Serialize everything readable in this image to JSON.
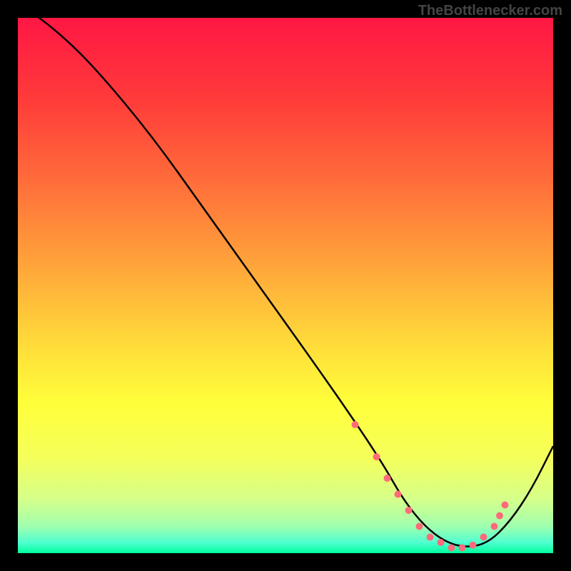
{
  "watermark": "TheBottlenecker.com",
  "chart_data": {
    "type": "line",
    "title": "",
    "xlabel": "",
    "ylabel": "",
    "xlim": [
      0,
      100
    ],
    "ylim": [
      0,
      100
    ],
    "gradient_stops": [
      {
        "offset": 0,
        "color": "#ff1744"
      },
      {
        "offset": 15,
        "color": "#ff3a3a"
      },
      {
        "offset": 30,
        "color": "#ff6b3a"
      },
      {
        "offset": 45,
        "color": "#ffa03a"
      },
      {
        "offset": 60,
        "color": "#ffd83a"
      },
      {
        "offset": 72,
        "color": "#ffff3a"
      },
      {
        "offset": 82,
        "color": "#f5ff5a"
      },
      {
        "offset": 90,
        "color": "#d5ff8a"
      },
      {
        "offset": 95,
        "color": "#a0ffb0"
      },
      {
        "offset": 98,
        "color": "#50ffd0"
      },
      {
        "offset": 100,
        "color": "#00ff9c"
      }
    ],
    "curve": {
      "x": [
        0,
        8,
        15,
        25,
        35,
        45,
        55,
        62,
        68,
        72,
        76,
        80,
        84,
        88,
        92,
        96,
        100
      ],
      "y": [
        103,
        97,
        90,
        78,
        64,
        50,
        36,
        26,
        17,
        10,
        5,
        2,
        1,
        2,
        6,
        12,
        20
      ]
    },
    "markers": {
      "x": [
        63,
        67,
        69,
        71,
        73,
        75,
        77,
        79,
        81,
        83,
        85,
        87,
        89,
        90,
        91
      ],
      "y": [
        24,
        18,
        14,
        11,
        8,
        5,
        3,
        2,
        1,
        1,
        1.5,
        3,
        5,
        7,
        9
      ],
      "color": "#ff6b7a",
      "radius": 5
    }
  }
}
